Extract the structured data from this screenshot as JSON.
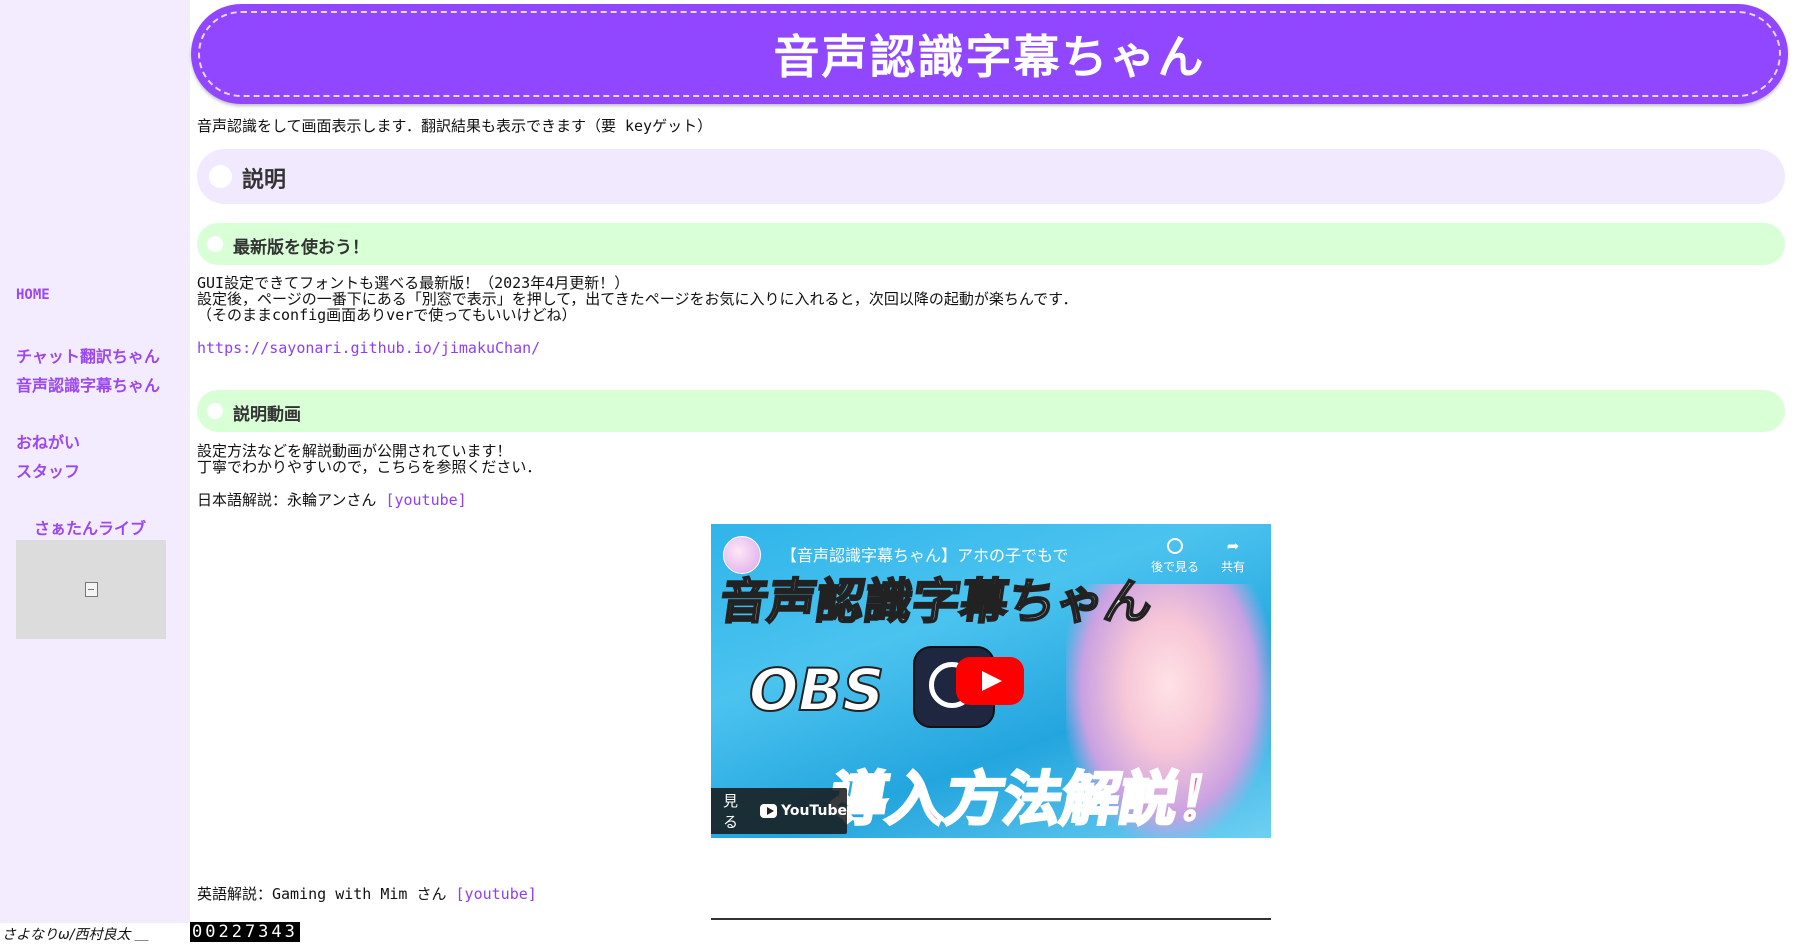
{
  "header": {
    "title": "音声認識字幕ちゃん"
  },
  "intro": "音声認識をして画面表示します．翻訳結果も表示できます（要 keyゲット）",
  "sidebar": {
    "home": "HOME",
    "items": [
      "チャット翻訳ちゃん",
      "音声認識字幕ちゃん",
      "おねがい",
      "スタッフ"
    ],
    "live_title": "さぁたんライブ"
  },
  "sections": {
    "main": "説明",
    "latest": {
      "title": "最新版を使おう！",
      "lines": [
        "GUI設定できてフォントも選べる最新版！（2023年4月更新！）",
        "設定後，ページの一番下にある「別窓で表示」を押して，出てきたページをお気に入りに入れると，次回以降の起動が楽ちんです．",
        "（そのままconfig画面ありverで使ってもいいけどね）"
      ],
      "url": "https://sayonari.github.io/jimakuChan/"
    },
    "video": {
      "title": "説明動画",
      "lines": [
        "設定方法などを解説動画が公開されています！",
        "丁寧でわかりやすいので，こちらを参照ください．"
      ],
      "jp_label": "日本語解説：永輪アンさん ",
      "en_label": "英語解説：Gaming with Mim さん ",
      "yt_link": "[youtube]"
    }
  },
  "video_player": {
    "title": "【音声認識字幕ちゃん】アホの子でもで",
    "big_text": "音声認識字幕ちゃん",
    "obs_text": "OBS",
    "bottom_text": "導入方法解説！",
    "watch_later": "後で見る",
    "share": "共有",
    "watch_label": "見る",
    "youtube_word": "YouTube"
  },
  "footer": {
    "author": "さよなりω/西村良太  ＿",
    "counter": "00227343"
  }
}
